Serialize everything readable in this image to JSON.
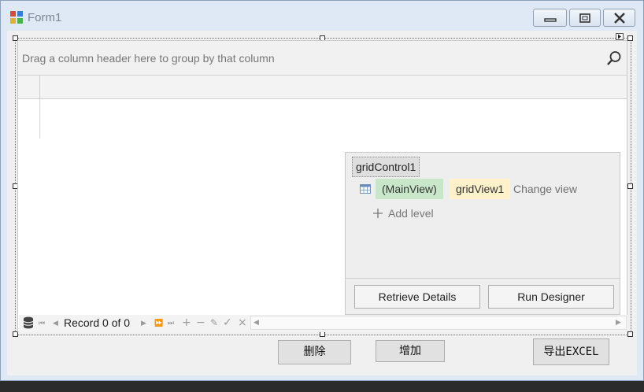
{
  "window": {
    "title": "Form1"
  },
  "grid": {
    "group_panel_text": "Drag a column header here to group by that column",
    "navigator": {
      "record_text": "Record 0 of 0"
    }
  },
  "smart_panel": {
    "control_name": "gridControl1",
    "main_view_label": "(MainView)",
    "view_name": "gridView1",
    "change_view_label": "Change view",
    "add_level_label": "Add level",
    "retrieve_details_label": "Retrieve Details",
    "run_designer_label": "Run Designer"
  },
  "buttons": {
    "delete_label": "删除",
    "add_label": "增加",
    "export_label": "导出EXCEL"
  },
  "colors": {
    "mainview_bg": "#c8e6c9",
    "gridview_bg": "#fff1c9",
    "titlebar_bg": "#dfe9f5"
  }
}
